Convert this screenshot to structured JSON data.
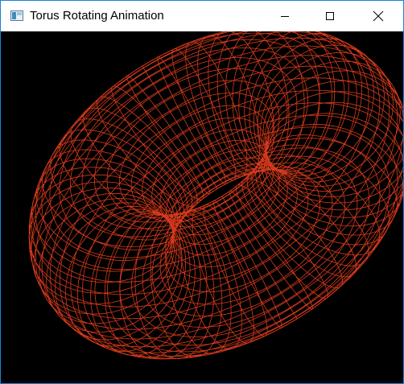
{
  "window": {
    "title": "Torus Rotating Animation",
    "controls": {
      "minimize": "minimize",
      "maximize": "maximize",
      "close": "close"
    }
  },
  "icons": {
    "app": "app-window-icon",
    "minimize": "minimize-icon",
    "maximize": "maximize-icon",
    "close": "close-icon"
  },
  "scene": {
    "background": "#000000",
    "wire_color": "#d83a1c",
    "object": "torus wireframe"
  },
  "colors": {
    "window_border": "#1883d7",
    "titlebar_bg": "#ffffff"
  }
}
